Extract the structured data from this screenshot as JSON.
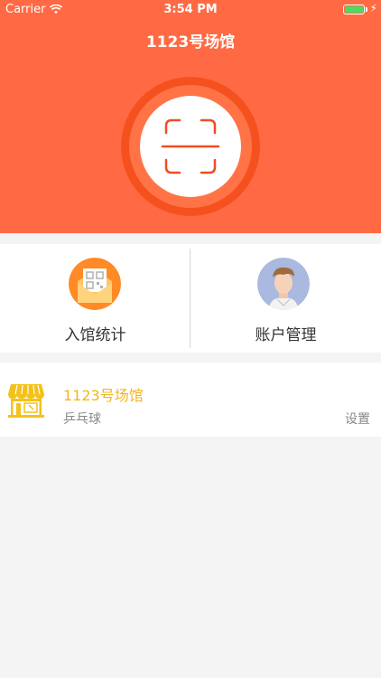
{
  "status_bar": {
    "carrier": "Carrier",
    "time": "3:54 PM",
    "battery_percent": 100,
    "icons": [
      "wifi-icon",
      "battery-icon",
      "charging-icon"
    ]
  },
  "nav": {
    "title": "1123号场馆"
  },
  "scan": {
    "icon": "scan-icon"
  },
  "menu": [
    {
      "label": "入馆统计",
      "icon": "qr-envelope-icon"
    },
    {
      "label": "账户管理",
      "icon": "avatar-icon"
    }
  ],
  "venue": {
    "name": "1123号场馆",
    "type": "乒乓球",
    "settings_label": "设置",
    "icon": "shop-icon"
  },
  "colors": {
    "header_bg": "#ff6a44",
    "scan_stroke": "#f04d22",
    "venue_accent": "#f3b51c",
    "page_bg": "#f4f4f4"
  }
}
